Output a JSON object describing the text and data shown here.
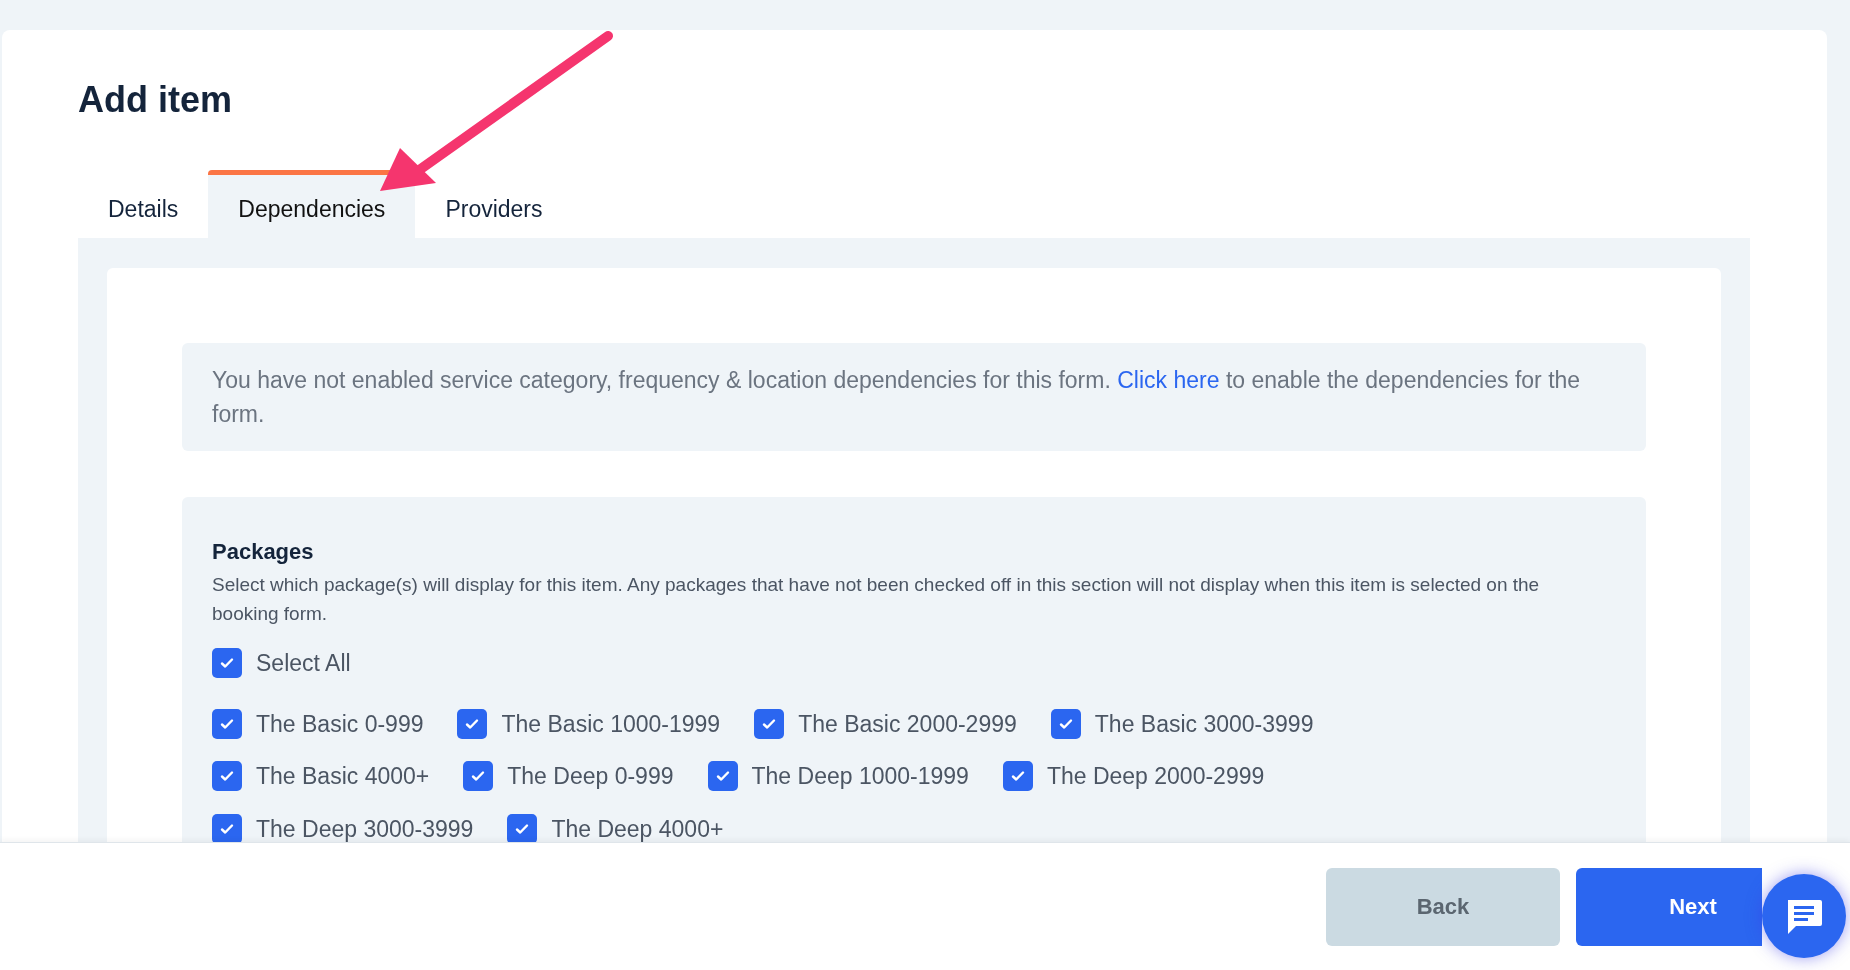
{
  "title": "Add item",
  "tabs": [
    {
      "label": "Details",
      "selected": false
    },
    {
      "label": "Dependencies",
      "selected": true
    },
    {
      "label": "Providers",
      "selected": false
    }
  ],
  "notice": {
    "text": "You have not enabled service category, frequency & location dependencies for this form.",
    "link": "Click here",
    "text_after": "to enable the dependencies for the form."
  },
  "packages": {
    "title": "Packages",
    "description": "Select which package(s) will display for this item. Any packages that have not been checked off in this section will not display when this item is selected on the booking form.",
    "select_all": {
      "label": "Select All",
      "checked": true
    },
    "items": [
      {
        "label": "The Basic 0-999",
        "checked": true
      },
      {
        "label": "The Basic 1000-1999",
        "checked": true
      },
      {
        "label": "The Basic 2000-2999",
        "checked": true
      },
      {
        "label": "The Basic 3000-3999",
        "checked": true
      },
      {
        "label": "The Basic 4000+",
        "checked": true
      },
      {
        "label": "The Deep 0-999",
        "checked": true
      },
      {
        "label": "The Deep 1000-1999",
        "checked": true
      },
      {
        "label": "The Deep 2000-2999",
        "checked": true
      },
      {
        "label": "The Deep 3000-3999",
        "checked": true
      },
      {
        "label": "The Deep 4000+",
        "checked": true
      }
    ]
  },
  "buttons": [
    {
      "label": "Back",
      "kind": "secondary"
    },
    {
      "label": "Next",
      "kind": "primary"
    }
  ]
}
